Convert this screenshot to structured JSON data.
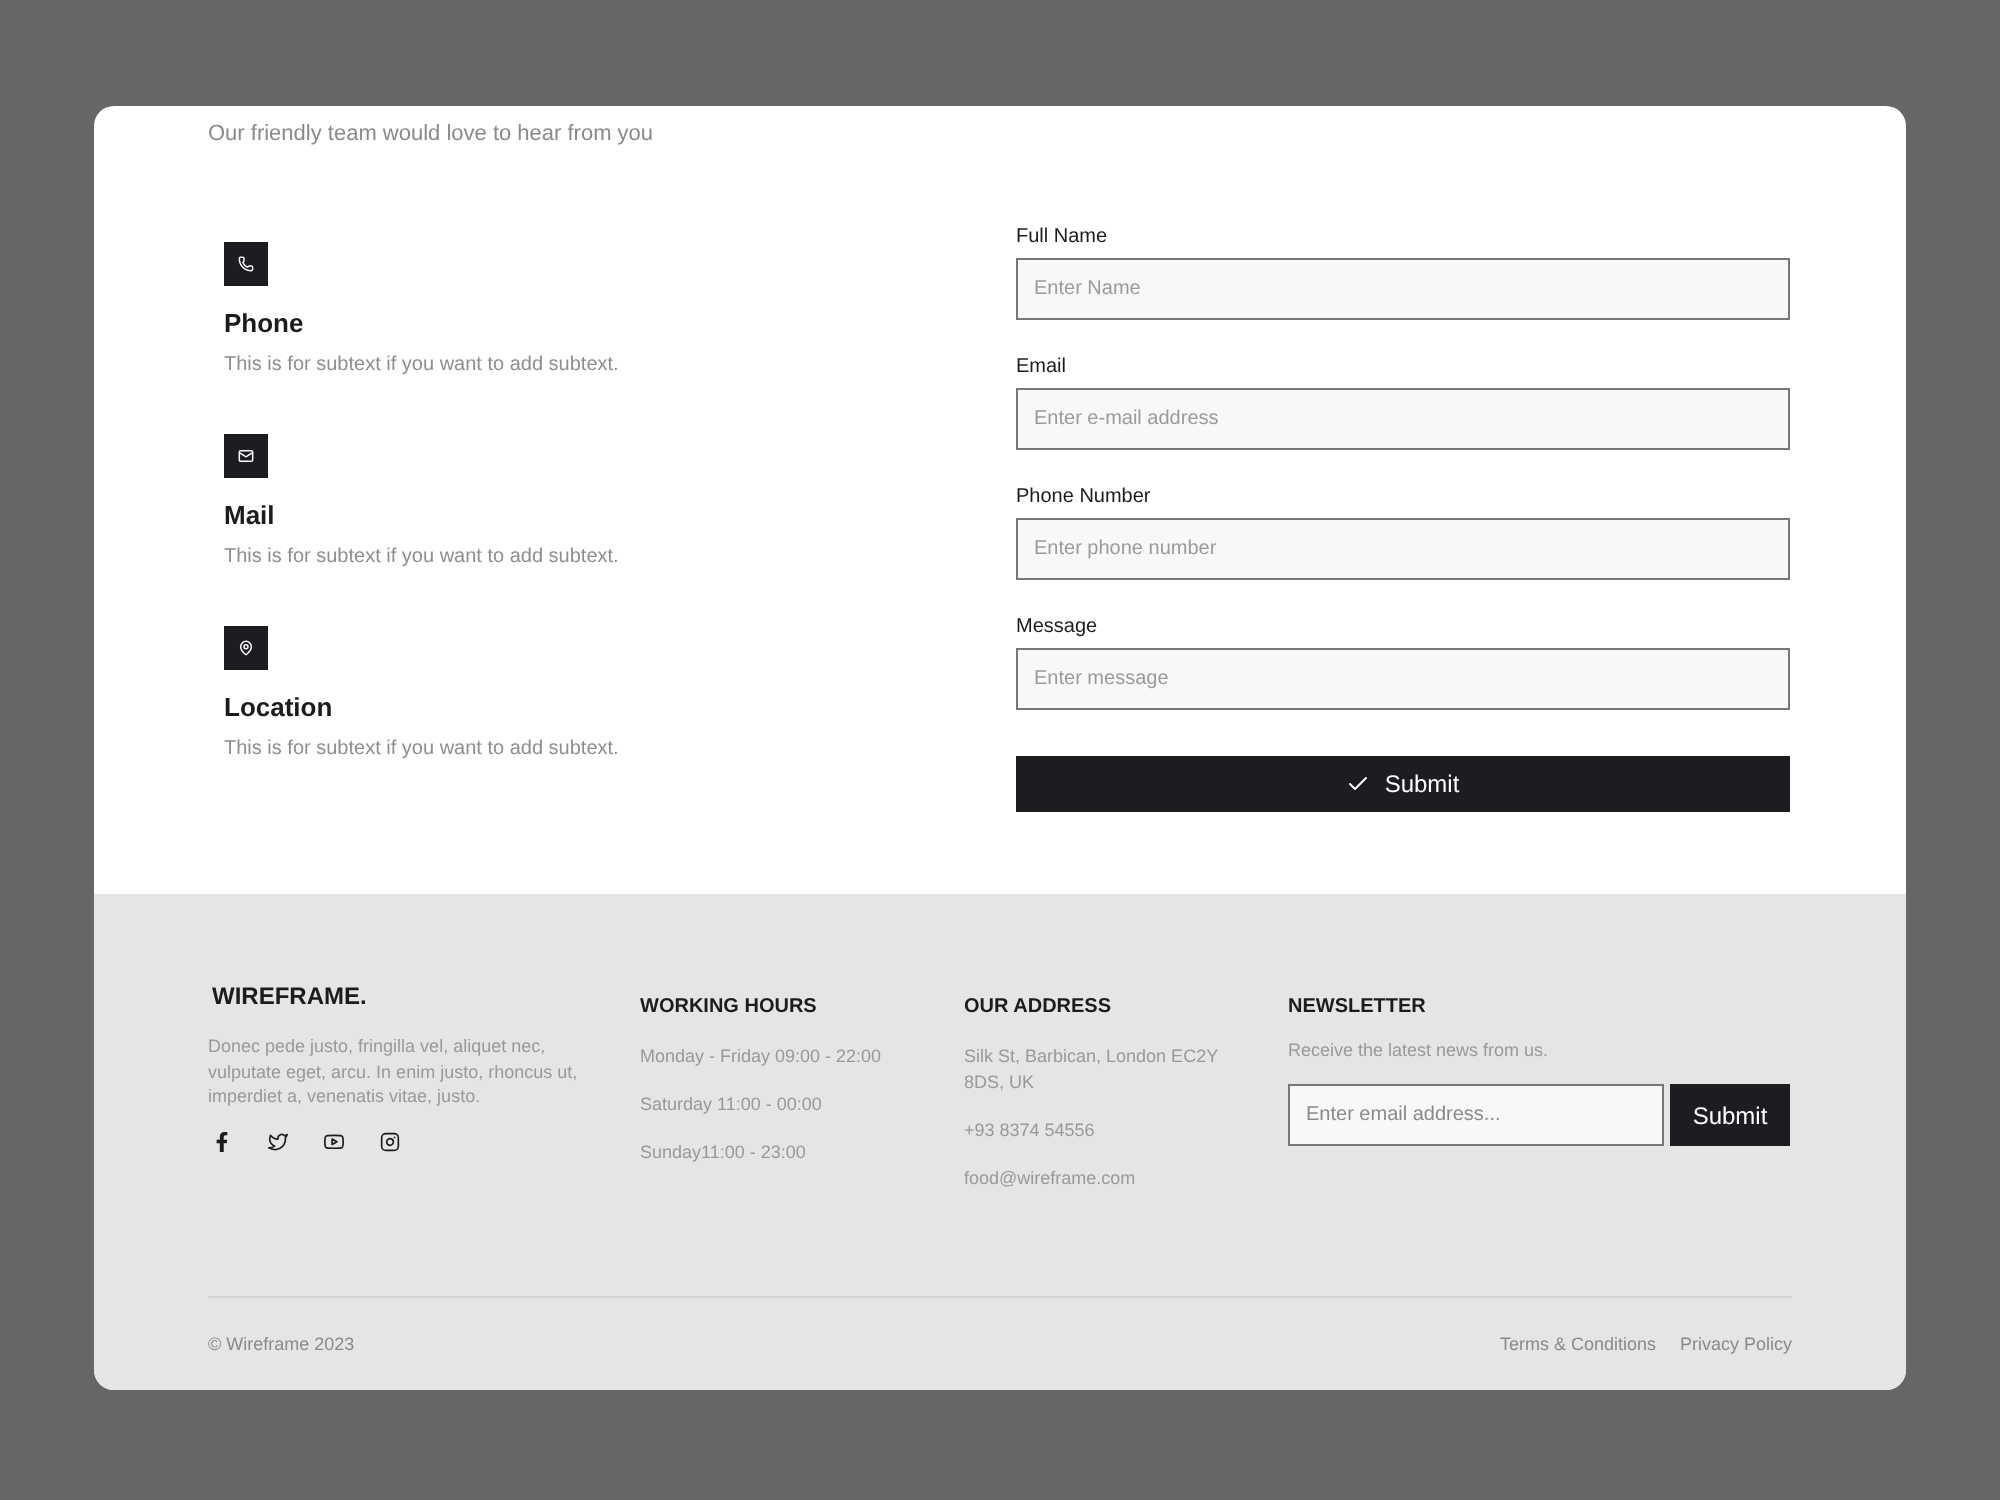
{
  "header": {
    "subtitle": "Our friendly team would love to hear from you"
  },
  "contact_methods": [
    {
      "kind": "phone",
      "title": "Phone",
      "subtext": "This is for subtext if you want to add subtext."
    },
    {
      "kind": "mail",
      "title": "Mail",
      "subtext": "This is for subtext if you want to add subtext."
    },
    {
      "kind": "location",
      "title": "Location",
      "subtext": "This is for subtext if you want to add subtext."
    }
  ],
  "form": {
    "fields": [
      {
        "label": "Full Name",
        "placeholder": "Enter Name"
      },
      {
        "label": "Email",
        "placeholder": "Enter e-mail address"
      },
      {
        "label": "Phone Number",
        "placeholder": "Enter phone number"
      },
      {
        "label": "Message",
        "placeholder": "Enter message"
      }
    ],
    "submit_button": "Submit"
  },
  "footer": {
    "brand": "WIREFRAME.",
    "description": "Donec pede justo, fringilla vel, aliquet nec, vulputate eget, arcu. In enim justo, rhoncus ut, imperdiet a, venenatis vitae, justo.",
    "working_hours": {
      "title": "WORKING HOURS",
      "lines": [
        "Monday - Friday 09:00 - 22:00",
        "Saturday 11:00 - 00:00",
        "Sunday11:00 - 23:00"
      ]
    },
    "address": {
      "title": "OUR ADDRESS",
      "lines": [
        "Silk St, Barbican, London EC2Y 8DS, UK",
        "+93 8374 54556",
        "food@wireframe.com"
      ]
    },
    "newsletter": {
      "title": "NEWSLETTER",
      "text": "Receive the latest news from us.",
      "placeholder": "Enter email address...",
      "button": "Submit"
    },
    "copyright": "© Wireframe 2023",
    "links": [
      "Terms & Conditions",
      "Privacy Policy"
    ]
  }
}
